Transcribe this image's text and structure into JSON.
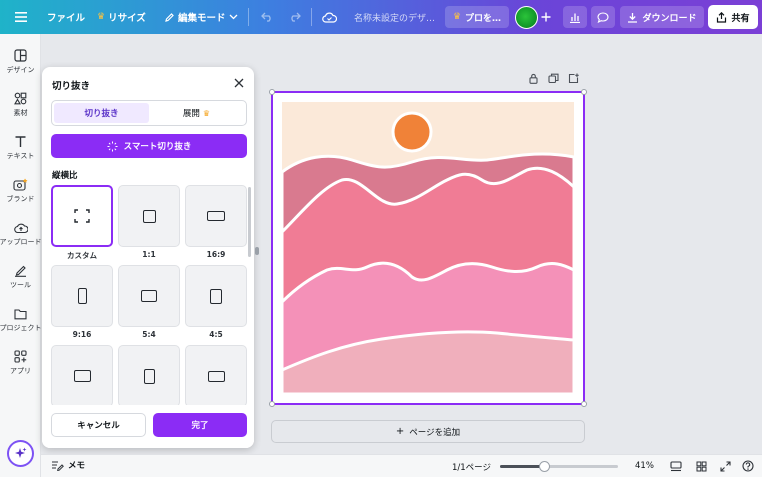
{
  "topbar": {
    "menu_icon": "hamburger-icon",
    "file_label": "ファイル",
    "resize_label": "リサイズ",
    "edit_mode_label": "編集モード",
    "doc_name": "名称未設定のデザ…",
    "pro_label": "プロを…",
    "download_label": "ダウンロード",
    "share_label": "共有"
  },
  "rail": {
    "items": [
      {
        "label": "デザイン",
        "icon": "layout-icon"
      },
      {
        "label": "素材",
        "icon": "shapes-icon"
      },
      {
        "label": "テキスト",
        "icon": "text-icon"
      },
      {
        "label": "ブランド",
        "icon": "brand-icon"
      },
      {
        "label": "アップロード",
        "icon": "cloud-upload-icon"
      },
      {
        "label": "ツール",
        "icon": "draw-icon"
      },
      {
        "label": "プロジェクト",
        "icon": "folder-icon"
      },
      {
        "label": "アプリ",
        "icon": "apps-icon"
      }
    ]
  },
  "crop_panel": {
    "title": "切り抜き",
    "tabs": [
      {
        "label": "切り抜き",
        "active": true
      },
      {
        "label": "展開",
        "active": false
      }
    ],
    "smart_crop_label": "スマート切り抜き",
    "ratio_heading": "縦横比",
    "ratios": [
      {
        "label": "カスタム",
        "shape": "custom",
        "selected": true
      },
      {
        "label": "1:1",
        "shape": "square"
      },
      {
        "label": "16:9",
        "shape": "wide"
      },
      {
        "label": "9:16",
        "shape": "tall"
      },
      {
        "label": "5:4",
        "shape": "landscape"
      },
      {
        "label": "4:5",
        "shape": "portrait"
      },
      {
        "label": "",
        "shape": "wide-mid"
      },
      {
        "label": "",
        "shape": "portrait"
      },
      {
        "label": "",
        "shape": "wide-mid"
      }
    ],
    "cancel_label": "キャンセル",
    "done_label": "完了"
  },
  "canvas": {
    "add_page_label": "ページを追加"
  },
  "bottombar": {
    "memo_label": "メモ",
    "page_indicator": "1/1ページ",
    "zoom_level": "41%",
    "zoom_fraction": 0.37
  },
  "colors": {
    "accent": "#8b2cf5",
    "sky": "#fbe9d9",
    "sun": "#f08238",
    "mountain1": "#d97a8f",
    "mountain2": "#f07c95",
    "mountain3": "#f491b8",
    "mountain4": "#f0afbc"
  }
}
